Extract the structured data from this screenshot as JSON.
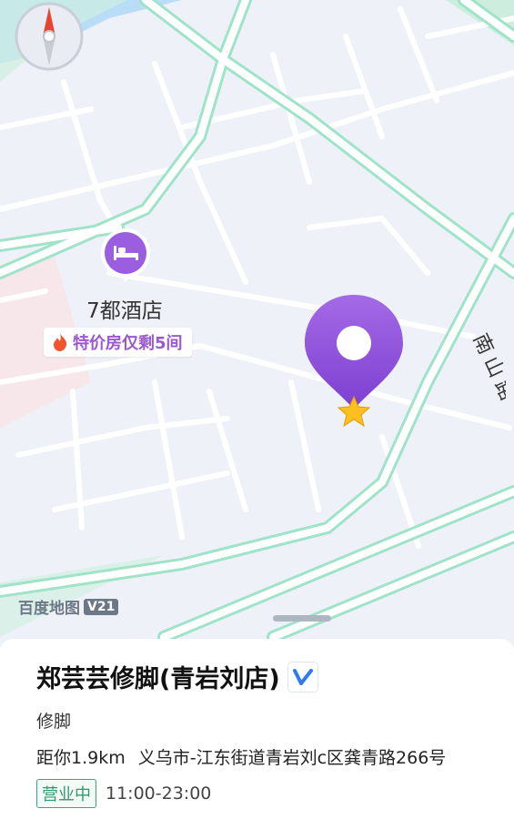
{
  "map": {
    "poi_hotel": {
      "name": "7都酒店",
      "promo": "特价房仅剩5间",
      "icon": "bed-icon",
      "promo_icon": "fire-icon"
    },
    "road_label": "南山路",
    "watermark": {
      "text": "百度地图",
      "version": "V21"
    },
    "selected_pin": {
      "icon": "location-pin-icon",
      "marker": "star-icon"
    },
    "compass": {
      "icon": "compass-icon"
    },
    "colors": {
      "road_outline": "#9fe3c8",
      "road_fill": "#ffffff",
      "land": "#eef2f8",
      "accent_purple": "#8a4fd8",
      "status_green": "#2f9a70"
    }
  },
  "place": {
    "title": "郑芸芸修脚(青岩刘店)",
    "verified_icon": "verified-v-icon",
    "category": "修脚",
    "distance": "距你1.9km",
    "address": "义乌市-江东街道青岩刘c区龚青路266号",
    "status": "营业中",
    "hours": "11:00-23:00"
  }
}
